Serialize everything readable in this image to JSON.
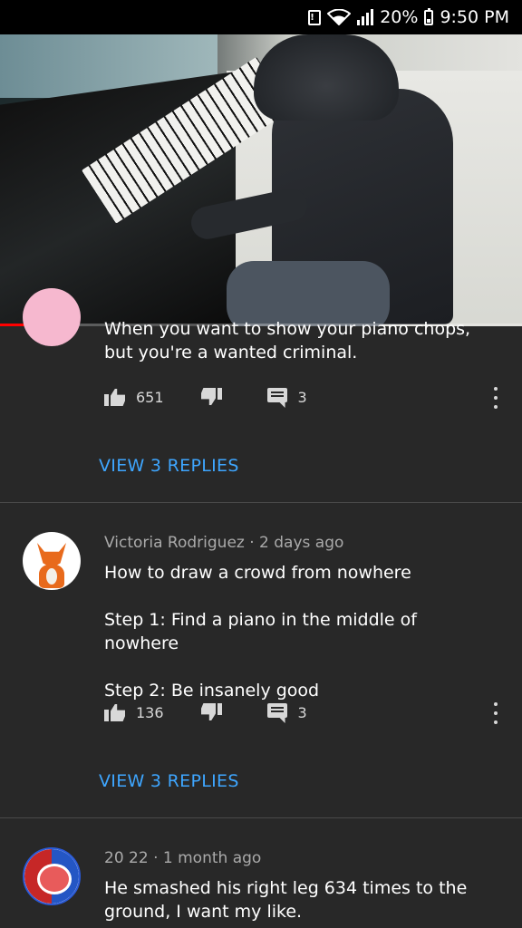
{
  "status_bar": {
    "alert_icon": "alert-box-icon",
    "wifi_icon": "wifi-icon",
    "signal_icon": "signal-icon",
    "battery_percent": "20%",
    "battery_icon": "battery-icon",
    "time": "9:50 PM"
  },
  "video": {
    "progress": 0.05,
    "progress_color": "#ff0000"
  },
  "comments": [
    {
      "author": "",
      "text_lines": [
        "When you want to show your piano chops, but you're a wanted criminal."
      ],
      "likes": "651",
      "replies_count": "3",
      "view_replies": "VIEW 3 REPLIES"
    },
    {
      "author": "Victoria Rodriguez",
      "time": "2 days ago",
      "text_lines": [
        "How to draw a crowd from nowhere",
        "",
        "Step 1: Find a piano in the middle of nowhere",
        "",
        "Step 2: Be insanely good"
      ],
      "likes": "136",
      "replies_count": "3",
      "view_replies": "VIEW 3 REPLIES"
    },
    {
      "author": "20 22",
      "time": "1 month ago",
      "text_lines": [
        "He smashed his right leg 634 times to the ground, I want my like."
      ]
    }
  ],
  "colors": {
    "background": "#282828",
    "link": "#3ea6ff",
    "secondary_text": "#aaaaaa"
  }
}
